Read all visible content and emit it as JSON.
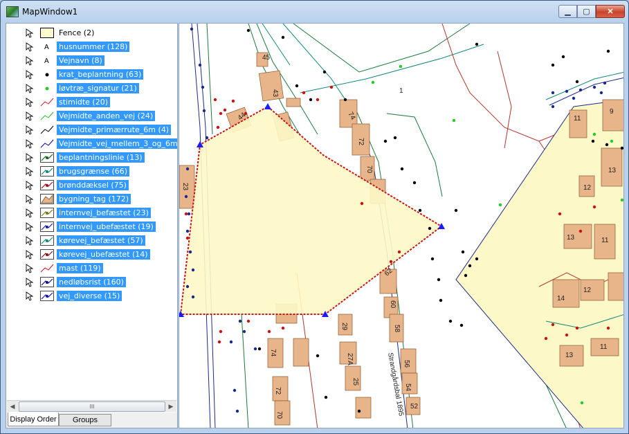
{
  "window": {
    "title": "MapWindow1",
    "minimize": "▁",
    "maximize": "▢",
    "close": "✕"
  },
  "legend": {
    "layers": [
      {
        "label": "Fence (2)",
        "symbol": "polygon",
        "color": "#fffacd",
        "selected": false
      },
      {
        "label": "husnummer (128)",
        "symbol": "text",
        "color": "#000000",
        "selected": true
      },
      {
        "label": "Vejnavn (8)",
        "symbol": "text",
        "color": "#000000",
        "selected": true
      },
      {
        "label": "krat_beplantning (63)",
        "symbol": "point",
        "color": "#000000",
        "selected": true
      },
      {
        "label": "løvtræ_signatur (21)",
        "symbol": "point",
        "color": "#22cc22",
        "selected": true
      },
      {
        "label": "stimidte (20)",
        "symbol": "line",
        "color": "#cc2222",
        "selected": true
      },
      {
        "label": "Vejmidte_anden_vej (24)",
        "symbol": "line",
        "color": "#22bb22",
        "selected": true
      },
      {
        "label": "Vejmidte_primærrute_6m (4)",
        "symbol": "line",
        "color": "#000000",
        "selected": true
      },
      {
        "label": "Vejmidte_vej_mellem_3_og_6m (8)",
        "symbol": "line",
        "color": "#000099",
        "selected": true
      },
      {
        "label": "beplantningslinie (13)",
        "symbol": "linept",
        "color": "#116611",
        "selected": true
      },
      {
        "label": "brugsgrænse (66)",
        "symbol": "linept",
        "color": "#118877",
        "selected": true
      },
      {
        "label": "brønddæksel (75)",
        "symbol": "linept",
        "color": "#991111",
        "selected": true
      },
      {
        "label": "bygning_tag (172)",
        "symbol": "poly",
        "color": "#e8b48a",
        "selected": true
      },
      {
        "label": "internvej_befæstet (23)",
        "symbol": "linept",
        "color": "#777711",
        "selected": true
      },
      {
        "label": "internvej_ubefæstet (19)",
        "symbol": "linept",
        "color": "#1122aa",
        "selected": true
      },
      {
        "label": "kørevej_befæstet (57)",
        "symbol": "linept",
        "color": "#118877",
        "selected": true
      },
      {
        "label": "kørevej_ubefæstet (14)",
        "symbol": "linept",
        "color": "#881111",
        "selected": true
      },
      {
        "label": "mast (119)",
        "symbol": "line",
        "color": "#cc1111",
        "selected": true
      },
      {
        "label": "nedløbsrist (160)",
        "symbol": "linept",
        "color": "#111177",
        "selected": true
      },
      {
        "label": "vej_diverse (15)",
        "symbol": "linept",
        "color": "#1111aa",
        "selected": true
      }
    ],
    "scroll_thumb": "III",
    "tabs": [
      "Display Order",
      "Groups"
    ]
  },
  "map": {
    "house_numbers": [
      "45",
      "43",
      "44",
      "74",
      "72",
      "70",
      "23",
      "62",
      "60",
      "58",
      "29",
      "27A",
      "25",
      "74",
      "72",
      "70",
      "56",
      "54",
      "52",
      "9",
      "11",
      "13",
      "12",
      "13",
      "11",
      "14",
      "12",
      "13",
      "11",
      "1"
    ],
    "road_label": "Strandgårdsbal 1895",
    "colors": {
      "fence_fill": "#fdf8c8",
      "building": "#e8b48a",
      "vertex": "#1a1aff",
      "fence_edge": "#cc1111"
    }
  }
}
